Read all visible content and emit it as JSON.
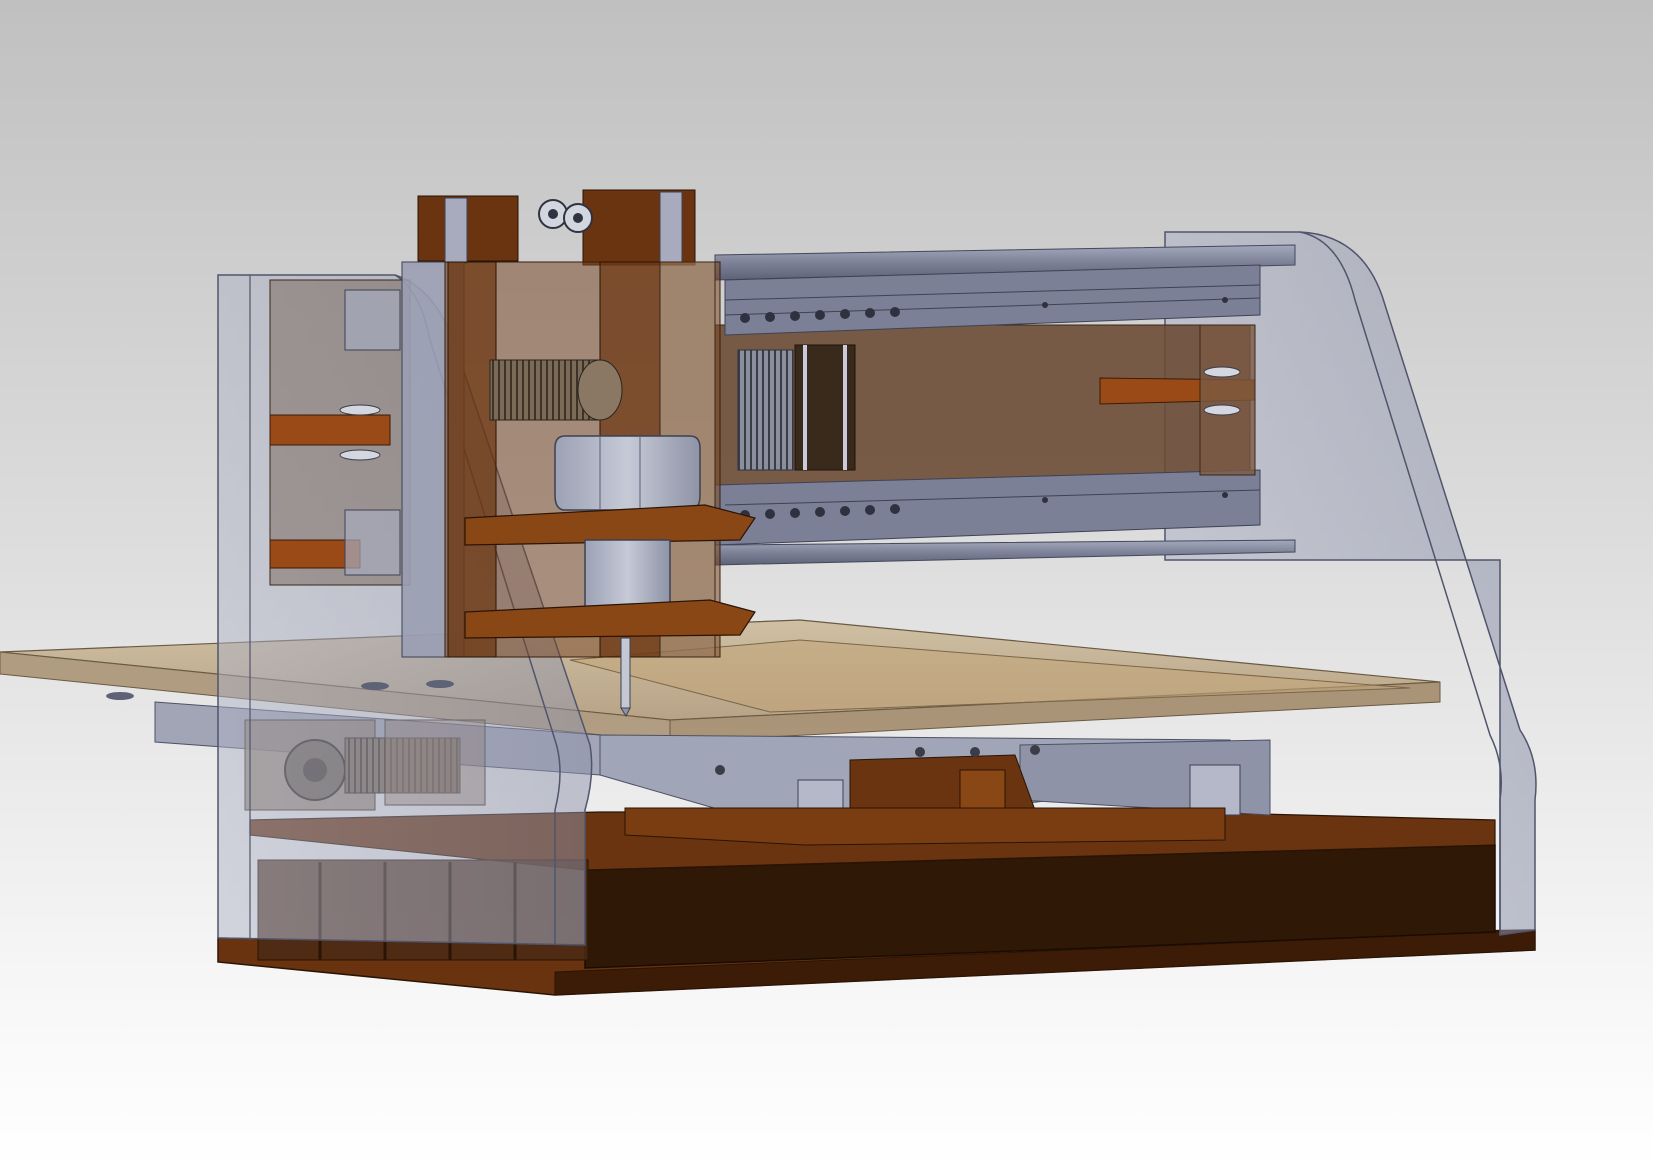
{
  "scene": {
    "viewport_background": [
      "#c0c0c0",
      "#ffffff"
    ],
    "materials": {
      "wood_dark": "#3a1f0a",
      "wood": "#6b3410",
      "wood_light": "#a0531c",
      "acrylic": "#9aa0b8",
      "acrylic_edge": "#5d6278",
      "aluminum": "#8e93a8",
      "aluminum_dark": "#5e6379",
      "steel": "#b7bccb",
      "spoilboard": "#b89a72"
    },
    "components": [
      "base-frame",
      "side-panel-left",
      "side-panel-right",
      "gantry-rails",
      "z-axis-carriage",
      "spindle-motor",
      "stepper-motor",
      "bed",
      "y-axis-rails",
      "y-axis-lead-screw"
    ]
  }
}
